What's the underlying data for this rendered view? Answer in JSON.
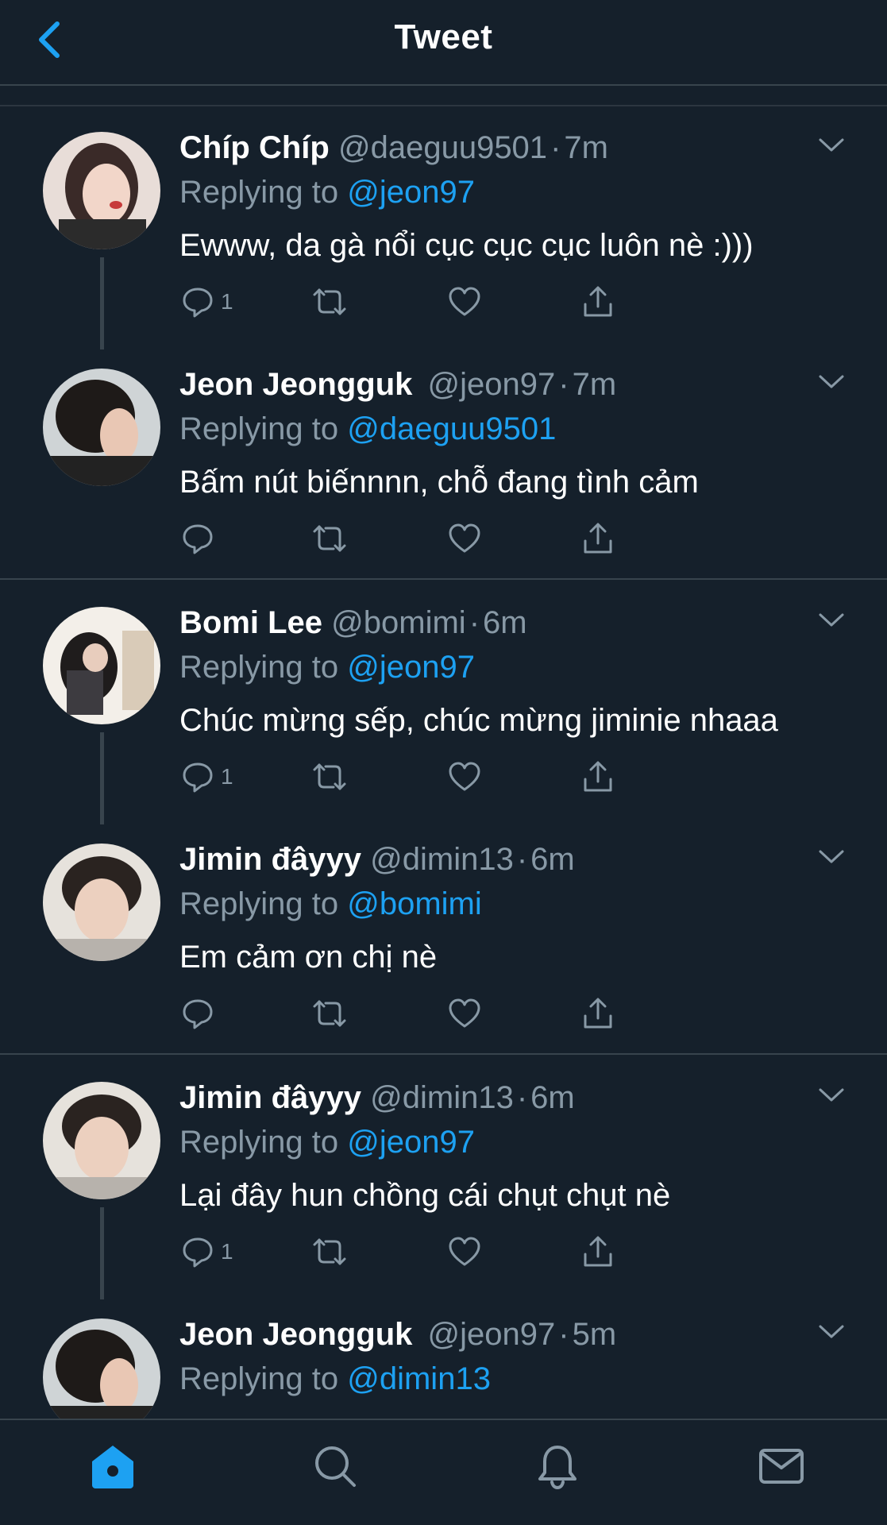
{
  "header": {
    "title": "Tweet",
    "back_icon": "chevron-left-icon"
  },
  "colors": {
    "background": "#15202b",
    "accent": "#1da1f2",
    "muted": "#8899a6",
    "border": "#38444d"
  },
  "tweets": [
    {
      "name": "Chíp Chíp",
      "handle": "@daeguu9501",
      "dot": "·",
      "time": "7m",
      "reply_label": "Replying to",
      "reply_to": "@jeon97",
      "text": "Ewww, da gà nổi cục cục cục luôn nè :)))",
      "reply_count": "1"
    },
    {
      "name": "Jeon Jeongguk",
      "handle": "@jeon97",
      "dot": "·",
      "time": "7m",
      "reply_label": "Replying to",
      "reply_to": "@daeguu9501",
      "text": "Bấm nút biếnnnn, chỗ đang tình cảm",
      "reply_count": ""
    },
    {
      "name": "Bomi Lee",
      "handle": "@bomimi",
      "dot": "·",
      "time": "6m",
      "reply_label": "Replying to",
      "reply_to": "@jeon97",
      "text": "Chúc mừng sếp, chúc mừng jiminie nhaaa",
      "reply_count": "1"
    },
    {
      "name": "Jimin đâyyy",
      "handle": "@dimin13",
      "dot": "·",
      "time": "6m",
      "reply_label": "Replying to",
      "reply_to": "@bomimi",
      "text": "Em cảm ơn chị nè",
      "reply_count": ""
    },
    {
      "name": "Jimin đâyyy",
      "handle": "@dimin13",
      "dot": "·",
      "time": "6m",
      "reply_label": "Replying to",
      "reply_to": "@jeon97",
      "text": "Lại đây hun chồng cái chụt chụt nè",
      "reply_count": "1"
    },
    {
      "name": "Jeon Jeongguk",
      "handle": "@jeon97",
      "dot": "·",
      "time": "5m",
      "reply_label": "Replying to",
      "reply_to": "@dimin13",
      "text": "",
      "reply_count": ""
    }
  ],
  "nav": [
    {
      "icon": "home-icon",
      "active": true
    },
    {
      "icon": "search-icon",
      "active": false
    },
    {
      "icon": "bell-icon",
      "active": false
    },
    {
      "icon": "mail-icon",
      "active": false
    }
  ]
}
